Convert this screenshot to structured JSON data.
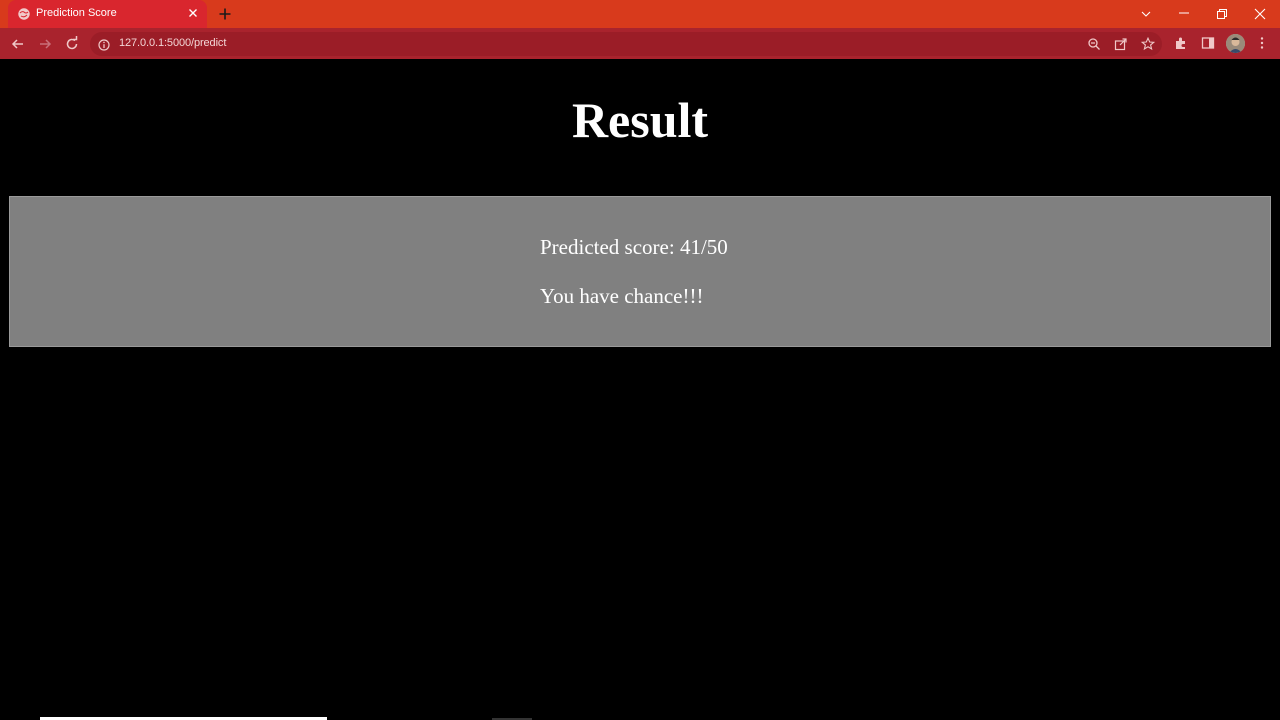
{
  "browser": {
    "tab_title": "Prediction Score",
    "url": "127.0.0.1:5000/predict"
  },
  "page": {
    "title": "Result",
    "predicted_score_text": "Predicted score: 41/50",
    "message": "You have chance!!!"
  },
  "colors": {
    "tabstrip": "#d83a1c",
    "active_tab": "#d9262e",
    "toolbar": "#a9232d",
    "page_background": "#000000",
    "result_box": "#808080"
  }
}
